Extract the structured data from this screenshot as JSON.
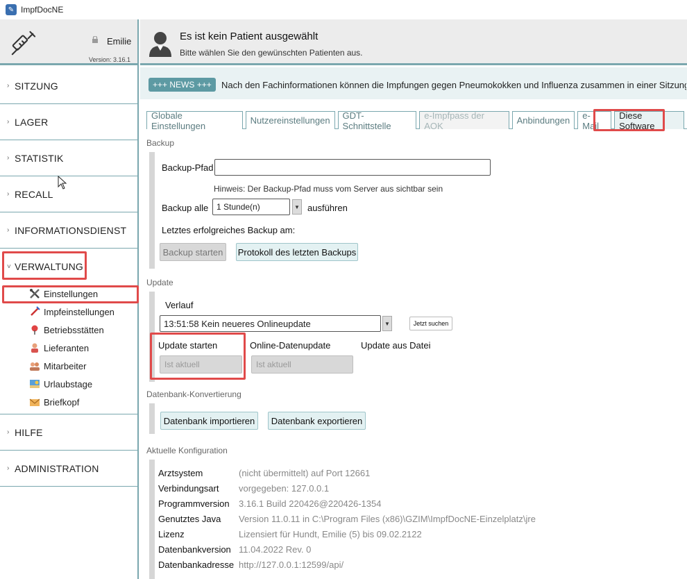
{
  "window": {
    "title": "ImpfDocNE"
  },
  "user": {
    "name": "Emilie",
    "version": "Version: 3.16.1"
  },
  "header": {
    "title": "Es ist kein Patient ausgewählt",
    "subtitle": "Bitte wählen Sie den gewünschten Patienten aus."
  },
  "news": {
    "badge": "+++ NEWS +++",
    "text": "Nach den Fachinformationen können die Impfungen gegen Pneumokokken und Influenza zusammen in einer Sitzung gegeben werden."
  },
  "nav": {
    "sitzung": "SITZUNG",
    "lager": "LAGER",
    "statistik": "STATISTIK",
    "recall": "RECALL",
    "informationsdienst": "INFORMATIONSDIENST",
    "verwaltung": "VERWALTUNG",
    "hilfe": "HILFE",
    "administration": "ADMINISTRATION",
    "sub": {
      "einstellungen": "Einstellungen",
      "impfeinstellungen": "Impfeinstellungen",
      "betriebsstaetten": "Betriebsstätten",
      "lieferanten": "Lieferanten",
      "mitarbeiter": "Mitarbeiter",
      "urlaubstage": "Urlaubstage",
      "briefkopf": "Briefkopf"
    }
  },
  "tabs": {
    "globale": "Globale Einstellungen",
    "nutzer": "Nutzereinstellungen",
    "gdt": "GDT-Schnittstelle",
    "eimpfpass": "e-Impfpass der AOK",
    "anbindungen": "Anbindungen",
    "email": "e-Mail",
    "software": "Diese Software"
  },
  "backup": {
    "section": "Backup",
    "path_label": "Backup-Pfad",
    "path_value": "",
    "hint": "Hinweis: Der Backup-Pfad muss vom Server aus sichtbar sein",
    "interval_label": "Backup alle",
    "interval_value": "1 Stunde(n)",
    "interval_suffix": "ausführen",
    "last_label": "Letztes erfolgreiches Backup am:",
    "start_button": "Backup starten",
    "protocol_button": "Protokoll des letzten Backups"
  },
  "update": {
    "section": "Update",
    "history_label": "Verlauf",
    "history_value": "13:51:58  Kein neueres Onlineupdate",
    "search_button": "Jetzt suchen",
    "start_label": "Update starten",
    "online_label": "Online-Datenupdate",
    "file_label": "Update aus Datei",
    "start_status": "Ist aktuell",
    "online_status": "Ist aktuell"
  },
  "database": {
    "section": "Datenbank-Konvertierung",
    "import_button": "Datenbank importieren",
    "export_button": "Datenbank exportieren"
  },
  "config": {
    "section": "Aktuelle Konfiguration",
    "rows": [
      {
        "label": "Arztsystem",
        "value": "(nicht übermittelt) auf Port 12661"
      },
      {
        "label": "Verbindungsart",
        "value": "vorgegeben: 127.0.0.1"
      },
      {
        "label": "Programmversion",
        "value": "3.16.1 Build 220426@220426-1354"
      },
      {
        "label": "Genutztes Java",
        "value": "Version 11.0.11 in C:\\Program Files (x86)\\GZIM\\ImpfDocNE-Einzelplatz\\jre"
      },
      {
        "label": "Lizenz",
        "value": "Lizensiert für Hundt, Emilie (5) bis 09.02.2122"
      },
      {
        "label": "Datenbankversion",
        "value": "11.04.2022 Rev. 0"
      },
      {
        "label": "Datenbankadresse",
        "value": "http://127.0.0.1:12599/api/"
      }
    ]
  }
}
